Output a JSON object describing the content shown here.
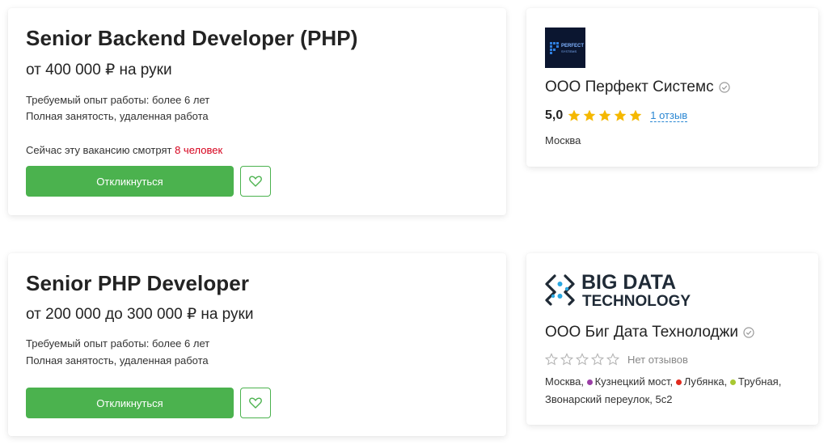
{
  "vacancies": [
    {
      "title": "Senior Backend Developer (PHP)",
      "salary": "от 400 000 ₽ на руки",
      "experience": "Требуемый опыт работы: более 6 лет",
      "employment": "Полная занятость, удаленная работа",
      "viewers_prefix": "Сейчас эту вакансию смотрят ",
      "viewers_count": "8 человек",
      "apply_label": "Откликнуться",
      "company": {
        "name": "ООО Перфект Системс",
        "logo_text": "PERFECT SYSTEMS",
        "rating": "5,0",
        "stars_filled": 5,
        "reviews": "1 отзыв",
        "city": "Москва"
      }
    },
    {
      "title": "Senior PHP Developer",
      "salary": "от 200 000 до 300 000 ₽ на руки",
      "experience": "Требуемый опыт работы: более 6 лет",
      "employment": "Полная занятость, удаленная работа",
      "apply_label": "Откликнуться",
      "company": {
        "name": "ООО Биг Дата Технолоджи",
        "logo_line1": "BIG DATA",
        "logo_line2": "TECHNOLOGY",
        "stars_filled": 0,
        "reviews": "Нет отзывов",
        "address": {
          "city": "Москва, ",
          "metro": [
            {
              "name": "Кузнецкий мост",
              "color": "#9b3ea6",
              "sep": ", "
            },
            {
              "name": "Лубянка",
              "color": "#e12a1e",
              "sep": ", "
            },
            {
              "name": "Трубная",
              "color": "#a8c832",
              "sep": ","
            }
          ],
          "street": "Звонарский переулок, 5с2"
        }
      }
    }
  ],
  "colors": {
    "accent": "#4bb24e",
    "link": "#2a87d3",
    "highlight": "#d6001c",
    "star": "#f5b800",
    "star_empty": "#b5b5b5"
  }
}
